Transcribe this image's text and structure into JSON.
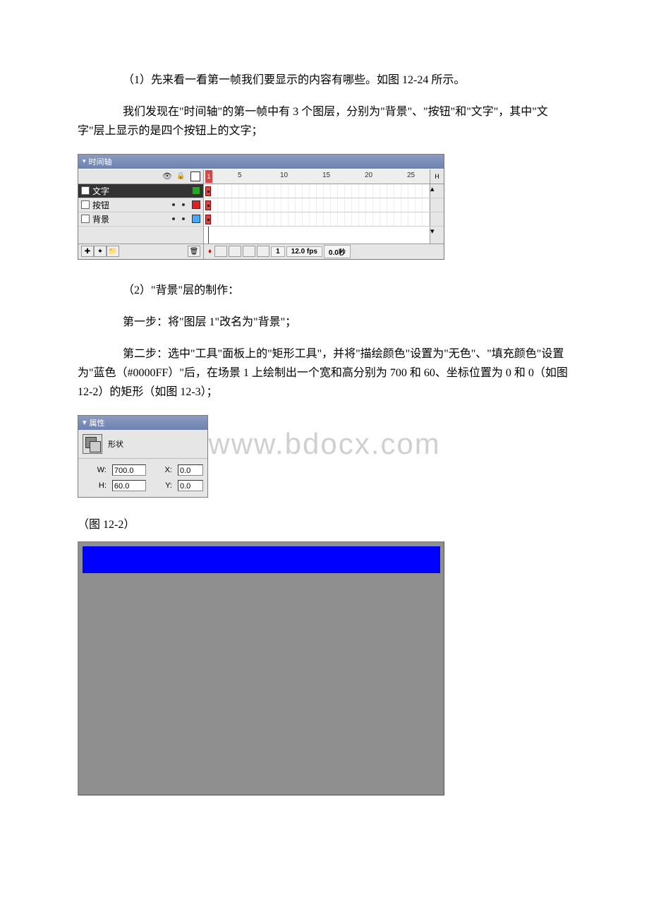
{
  "paragraphs": {
    "p1": "（1）先来看一看第一帧我们要显示的内容有哪些。如图 12-24 所示。",
    "p2": "我们发现在\"时间轴\"的第一帧中有 3 个图层，分别为\"背景\"、\"按钮\"和\"文字\"，其中\"文字\"层上显示的是四个按钮上的文字；",
    "p3": "（2）\"背景\"层的制作：",
    "p4": "第一步：将\"图层 1\"改名为\"背景\"；",
    "p5": "第二步：选中\"工具\"面板上的\"矩形工具\"，并将\"描绘颜色\"设置为\"无色\"、\"填充颜色\"设置为\"蓝色（#0000FF）\"后，在场景 1 上绘制出一个宽和高分别为 700 和 60、坐标位置为 0 和 0（如图 12-2）的矩形（如图 12-3）；"
  },
  "fig_label": "（图 12-2）",
  "watermark": "www.bdocx.com",
  "timeline": {
    "title": "时间轴",
    "ruler_marks": [
      "5",
      "10",
      "15",
      "20",
      "25"
    ],
    "frame1": "1",
    "end_btn": "H",
    "layers": [
      {
        "name": "文字",
        "swatch": "swatch-green",
        "selected": true
      },
      {
        "name": "按钮",
        "swatch": "swatch-red",
        "selected": false
      },
      {
        "name": "背景",
        "swatch": "swatch-blue",
        "selected": false
      }
    ],
    "status": {
      "frame": "1",
      "fps": "12.0 fps",
      "time": "0.0秒"
    }
  },
  "props": {
    "title": "属性",
    "type_label": "形状",
    "fields": {
      "w_lbl": "W:",
      "w_val": "700.0",
      "h_lbl": "H:",
      "h_val": "60.0",
      "x_lbl": "X:",
      "x_val": "0.0",
      "y_lbl": "Y:",
      "y_val": "0.0"
    }
  }
}
